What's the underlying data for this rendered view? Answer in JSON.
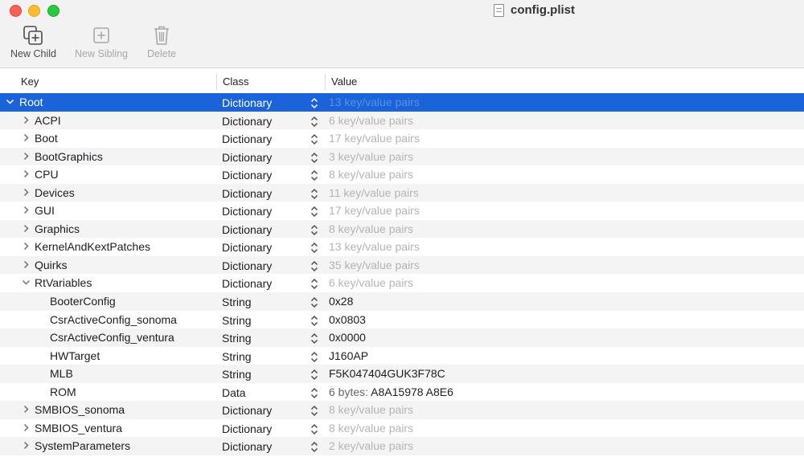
{
  "window": {
    "title": "config.plist"
  },
  "toolbar": {
    "new_child": "New Child",
    "new_sibling": "New Sibling",
    "delete": "Delete"
  },
  "columns": {
    "key": "Key",
    "class": "Class",
    "value": "Value"
  },
  "rows": [
    {
      "key": "Root",
      "level": 0,
      "disclosure": "expanded",
      "class": "Dictionary",
      "value": "13 key/value pairs",
      "value_dim": true,
      "selected": true
    },
    {
      "key": "ACPI",
      "level": 1,
      "disclosure": "collapsed",
      "class": "Dictionary",
      "value": "6 key/value pairs",
      "value_dim": true
    },
    {
      "key": "Boot",
      "level": 1,
      "disclosure": "collapsed",
      "class": "Dictionary",
      "value": "17 key/value pairs",
      "value_dim": true
    },
    {
      "key": "BootGraphics",
      "level": 1,
      "disclosure": "collapsed",
      "class": "Dictionary",
      "value": "3 key/value pairs",
      "value_dim": true
    },
    {
      "key": "CPU",
      "level": 1,
      "disclosure": "collapsed",
      "class": "Dictionary",
      "value": "8 key/value pairs",
      "value_dim": true
    },
    {
      "key": "Devices",
      "level": 1,
      "disclosure": "collapsed",
      "class": "Dictionary",
      "value": "11 key/value pairs",
      "value_dim": true
    },
    {
      "key": "GUI",
      "level": 1,
      "disclosure": "collapsed",
      "class": "Dictionary",
      "value": "17 key/value pairs",
      "value_dim": true
    },
    {
      "key": "Graphics",
      "level": 1,
      "disclosure": "collapsed",
      "class": "Dictionary",
      "value": "8 key/value pairs",
      "value_dim": true
    },
    {
      "key": "KernelAndKextPatches",
      "level": 1,
      "disclosure": "collapsed",
      "class": "Dictionary",
      "value": "13 key/value pairs",
      "value_dim": true
    },
    {
      "key": "Quirks",
      "level": 1,
      "disclosure": "collapsed",
      "class": "Dictionary",
      "value": "35 key/value pairs",
      "value_dim": true
    },
    {
      "key": "RtVariables",
      "level": 1,
      "disclosure": "expanded",
      "class": "Dictionary",
      "value": "6 key/value pairs",
      "value_dim": true
    },
    {
      "key": "BooterConfig",
      "level": 2,
      "disclosure": "none",
      "class": "String",
      "value": "0x28",
      "value_dim": false
    },
    {
      "key": "CsrActiveConfig_sonoma",
      "level": 2,
      "disclosure": "none",
      "class": "String",
      "value": "0x0803",
      "value_dim": false
    },
    {
      "key": "CsrActiveConfig_ventura",
      "level": 2,
      "disclosure": "none",
      "class": "String",
      "value": "0x0000",
      "value_dim": false
    },
    {
      "key": "HWTarget",
      "level": 2,
      "disclosure": "none",
      "class": "String",
      "value": "J160AP",
      "value_dim": false
    },
    {
      "key": "MLB",
      "level": 2,
      "disclosure": "none",
      "class": "String",
      "value": "F5K047404GUK3F78C",
      "value_dim": false
    },
    {
      "key": "ROM",
      "level": 2,
      "disclosure": "none",
      "class": "Data",
      "value": "6 bytes: A8A15978 A8E6",
      "value_dim": false
    },
    {
      "key": "SMBIOS_sonoma",
      "level": 1,
      "disclosure": "collapsed",
      "class": "Dictionary",
      "value": "8 key/value pairs",
      "value_dim": true
    },
    {
      "key": "SMBIOS_ventura",
      "level": 1,
      "disclosure": "collapsed",
      "class": "Dictionary",
      "value": "8 key/value pairs",
      "value_dim": true
    },
    {
      "key": "SystemParameters",
      "level": 1,
      "disclosure": "collapsed",
      "class": "Dictionary",
      "value": "2 key/value pairs",
      "value_dim": true
    }
  ]
}
